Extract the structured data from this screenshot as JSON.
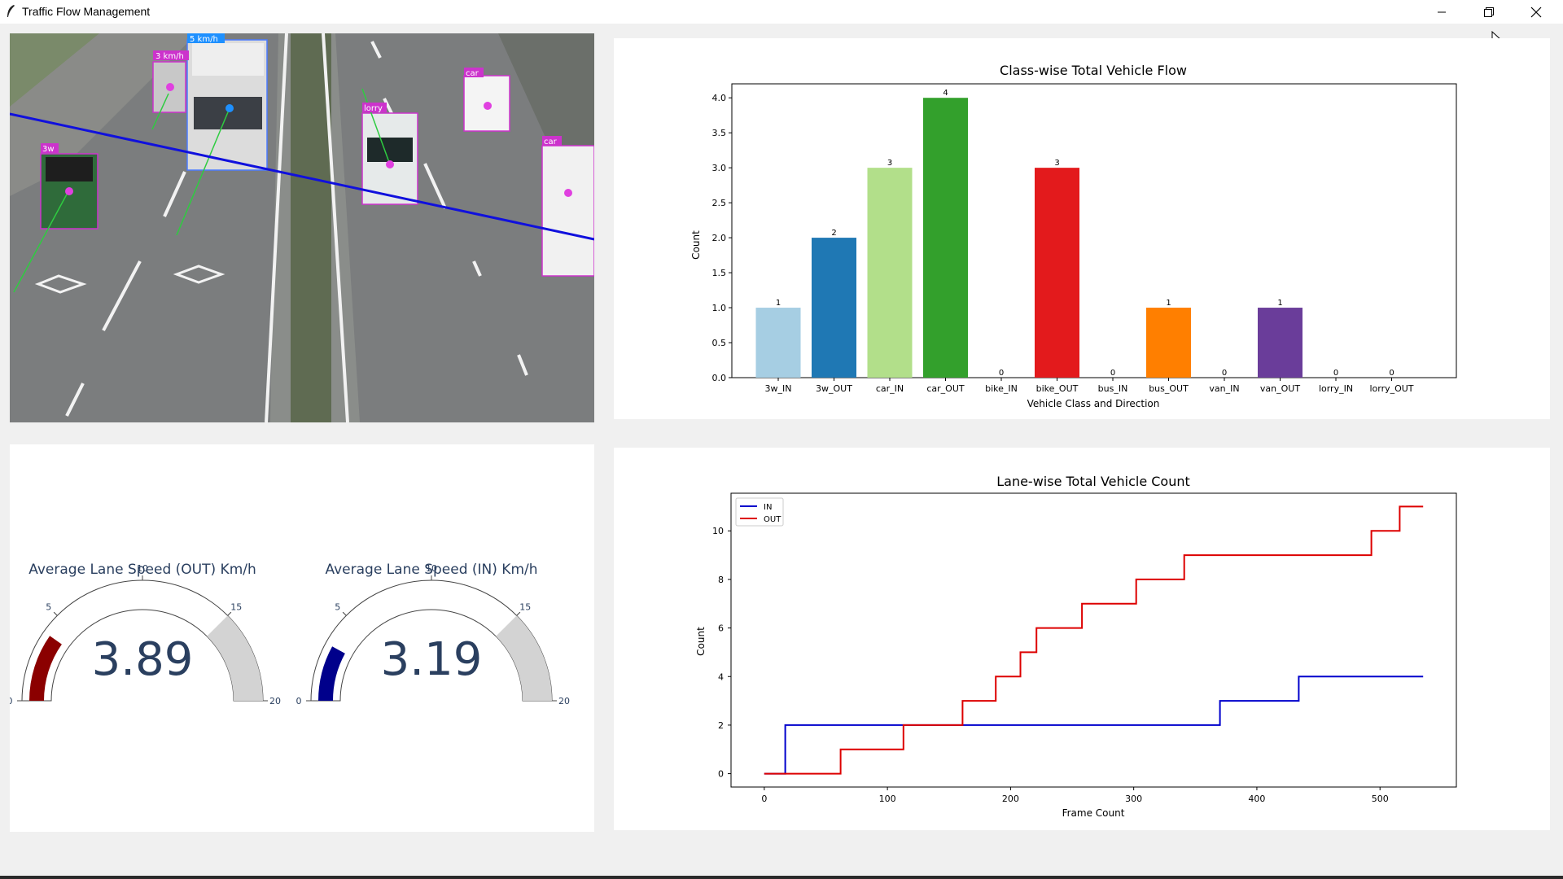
{
  "window": {
    "title": "Traffic Flow Management"
  },
  "video": {
    "detections": [
      {
        "label": "5 km/h",
        "color": "#1e90ff"
      },
      {
        "label": "3 km/h",
        "color": "#cc33cc"
      },
      {
        "label": "3w",
        "color": "#cc33cc"
      },
      {
        "label": "lorry",
        "color": "#cc33cc"
      },
      {
        "label": "car",
        "color": "#cc33cc"
      },
      {
        "label": "car",
        "color": "#cc33cc"
      }
    ]
  },
  "gauges": [
    {
      "title": "Average Lane Speed (OUT) Km/h",
      "value": 3.89,
      "display": "3.89",
      "min": 0,
      "max": 20,
      "ticks": [
        0,
        5,
        10,
        15,
        20
      ],
      "bar_color": "#8b0000",
      "step_from": 15,
      "step_color": "#d3d3d3"
    },
    {
      "title": "Average Lane Speed (IN) Km/h",
      "value": 3.19,
      "display": "3.19",
      "min": 0,
      "max": 20,
      "ticks": [
        0,
        5,
        10,
        15,
        20
      ],
      "bar_color": "#00008b",
      "step_from": 15,
      "step_color": "#d3d3d3"
    }
  ],
  "chart_data": [
    {
      "type": "bar",
      "title": "Class-wise Total Vehicle Flow",
      "xlabel": "Vehicle Class and Direction",
      "ylabel": "Count",
      "categories": [
        "3w_IN",
        "3w_OUT",
        "car_IN",
        "car_OUT",
        "bike_IN",
        "bike_OUT",
        "bus_IN",
        "bus_OUT",
        "van_IN",
        "van_OUT",
        "lorry_IN",
        "lorry_OUT"
      ],
      "values": [
        1,
        2,
        3,
        4,
        0,
        3,
        0,
        1,
        0,
        1,
        0,
        0
      ],
      "value_labels": [
        "1",
        "2",
        "3",
        "4",
        "0",
        "3",
        "0",
        "1",
        "0",
        "1",
        "0",
        "0"
      ],
      "colors": [
        "#a6cee3",
        "#1f78b4",
        "#b2df8a",
        "#33a02c",
        "#fb9a99",
        "#e31a1c",
        "#fdbf6f",
        "#ff7f00",
        "#cab2d6",
        "#6a3d9a",
        "#ffff99",
        "#b15928"
      ],
      "ylim": [
        0,
        4.2
      ],
      "yticks": [
        "0.0",
        "0.5",
        "1.0",
        "1.5",
        "2.0",
        "2.5",
        "3.0",
        "3.5",
        "4.0"
      ],
      "grid": false
    },
    {
      "type": "line",
      "title": "Lane-wise Total Vehicle Count",
      "xlabel": "Frame Count",
      "ylabel": "Count",
      "xlim": [
        -27,
        562
      ],
      "ylim": [
        -0.55,
        11.55
      ],
      "xticks": [
        0,
        100,
        200,
        300,
        400,
        500
      ],
      "yticks": [
        0,
        2,
        4,
        6,
        8,
        10
      ],
      "legend": "top-left",
      "grid": false,
      "series": [
        {
          "name": "IN",
          "color": "#0000cc",
          "points": [
            [
              0,
              0
            ],
            [
              17,
              0
            ],
            [
              17,
              2
            ],
            [
              370,
              2
            ],
            [
              370,
              3
            ],
            [
              434,
              3
            ],
            [
              434,
              4
            ],
            [
              535,
              4
            ]
          ]
        },
        {
          "name": "OUT",
          "color": "#dd0000",
          "points": [
            [
              0,
              0
            ],
            [
              62,
              0
            ],
            [
              62,
              1
            ],
            [
              113,
              1
            ],
            [
              113,
              2
            ],
            [
              161,
              2
            ],
            [
              161,
              3
            ],
            [
              188,
              3
            ],
            [
              188,
              4
            ],
            [
              208,
              4
            ],
            [
              208,
              5
            ],
            [
              221,
              5
            ],
            [
              221,
              6
            ],
            [
              258,
              6
            ],
            [
              258,
              7
            ],
            [
              302,
              7
            ],
            [
              302,
              8
            ],
            [
              341,
              8
            ],
            [
              341,
              9
            ],
            [
              493,
              9
            ],
            [
              493,
              10
            ],
            [
              516,
              10
            ],
            [
              516,
              11
            ],
            [
              535,
              11
            ]
          ]
        }
      ]
    }
  ]
}
